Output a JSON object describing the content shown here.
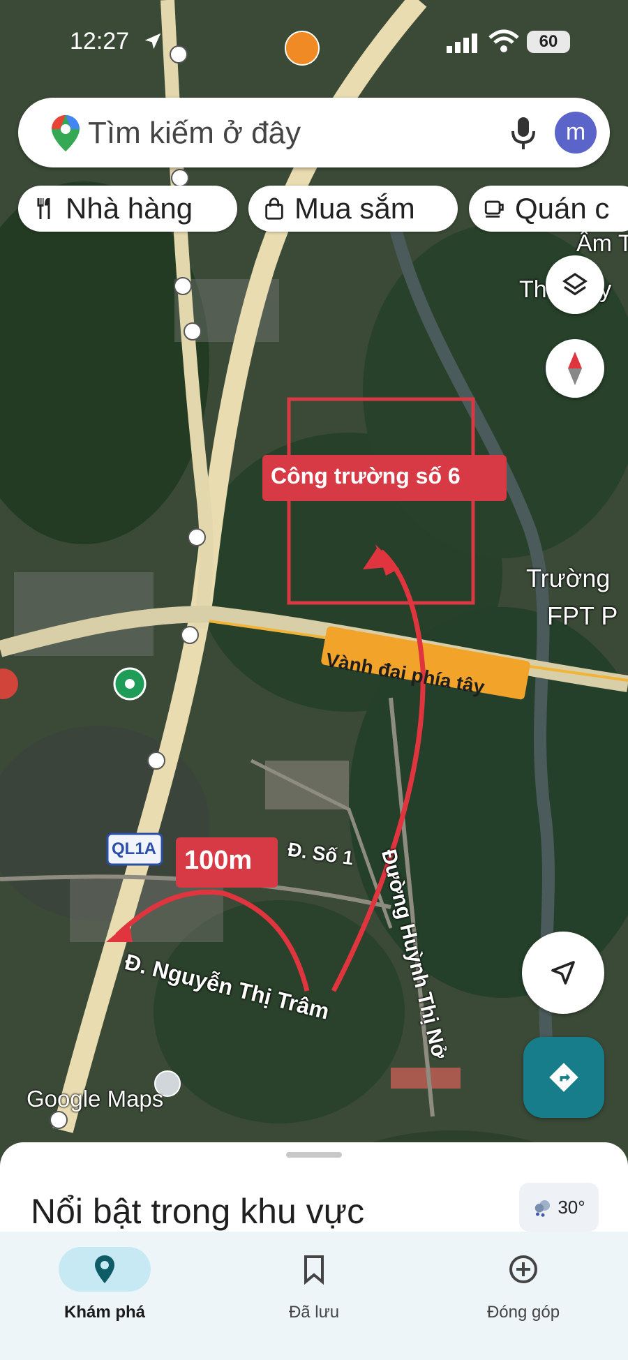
{
  "status_bar": {
    "time": "12:27",
    "battery": "60"
  },
  "search": {
    "placeholder": "Tìm kiếm ở đây",
    "avatar_letter": "m"
  },
  "chips": [
    {
      "label": "Nhà hàng",
      "icon": "restaurant-icon"
    },
    {
      "label": "Mua sắm",
      "icon": "shopping-bag-icon"
    },
    {
      "label": "Quán c",
      "icon": "coffee-icon"
    }
  ],
  "map_labels": {
    "site": "Công trường số 6",
    "ring_road": "Vành đai phía tây",
    "distance": "100m",
    "highway_shield": "QL1A",
    "street_so1": "Đ. Số 1",
    "street_nguyen": "Đ. Nguyễn Thị Trâm",
    "street_huynh": "Đường Huỳnh Thị Nở",
    "poi_fpt_line1": "Trường",
    "poi_fpt_line2": "FPT P",
    "poi_top_line1": "Ấm T",
    "poi_top_line2": "Th      ây",
    "google_maps": "Google Maps"
  },
  "panel": {
    "title": "Nổi bật trong khu vực",
    "weather": "30°"
  },
  "nav": [
    {
      "label": "Khám phá",
      "icon": "explore-pin-icon",
      "active": true
    },
    {
      "label": "Đã lưu",
      "icon": "bookmark-icon",
      "active": false
    },
    {
      "label": "Đóng góp",
      "icon": "add-circle-icon",
      "active": false
    }
  ],
  "colors": {
    "accent": "#177d8a",
    "site_box": "#d83a45",
    "ring_road_label": "#f2a32a",
    "active_pill": "#c6e9f3"
  }
}
